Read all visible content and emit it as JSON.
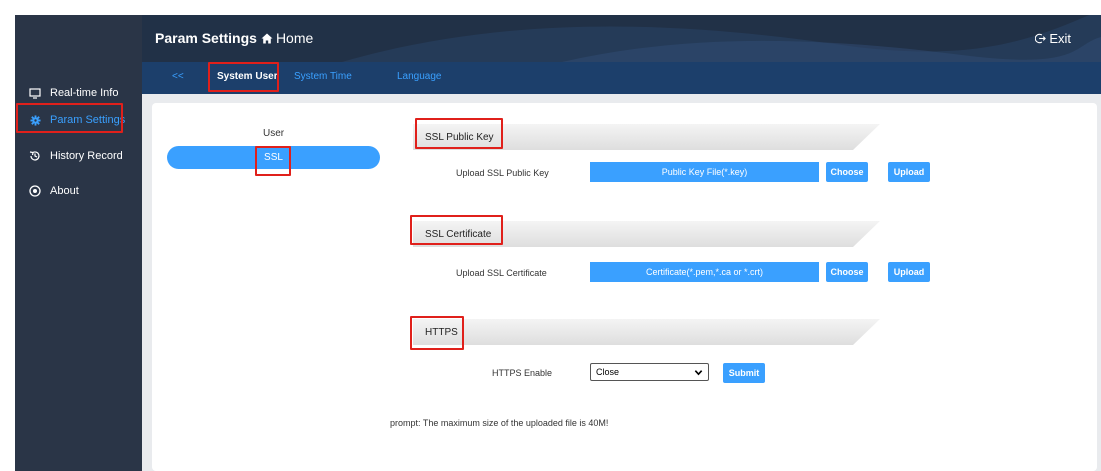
{
  "sidebar": {
    "items": [
      {
        "label": "Real-time Info",
        "icon": "monitor-icon"
      },
      {
        "label": "Param Settings",
        "icon": "gear-icon"
      },
      {
        "label": "History Record",
        "icon": "history-icon"
      },
      {
        "label": "About",
        "icon": "about-icon"
      }
    ]
  },
  "header": {
    "title": "Param Settings",
    "home": "Home",
    "exit": "Exit"
  },
  "tabs": {
    "back": "<<",
    "items": [
      "System User",
      "System Time",
      "Language"
    ]
  },
  "subnav": {
    "user": "User",
    "ssl": "SSL"
  },
  "ssl_public_key": {
    "title": "SSL Public Key",
    "label": "Upload SSL Public Key",
    "file": "Public Key File(*.key)",
    "choose": "Choose",
    "upload": "Upload"
  },
  "ssl_certificate": {
    "title": "SSL Certificate",
    "label": "Upload SSL Certificate",
    "file": "Certificate(*.pem,*.ca or *.crt)",
    "choose": "Choose",
    "upload": "Upload"
  },
  "https": {
    "title": "HTTPS",
    "label": "HTTPS Enable",
    "value": "Close",
    "submit": "Submit"
  },
  "prompt": "prompt:  The maximum size of the uploaded file is 40M!",
  "colors": {
    "accent": "#3aa0ff",
    "sidebar": "#2a3547",
    "header": "#213147",
    "tabbar": "#1c3f6b",
    "highlight": "#e0201b"
  }
}
